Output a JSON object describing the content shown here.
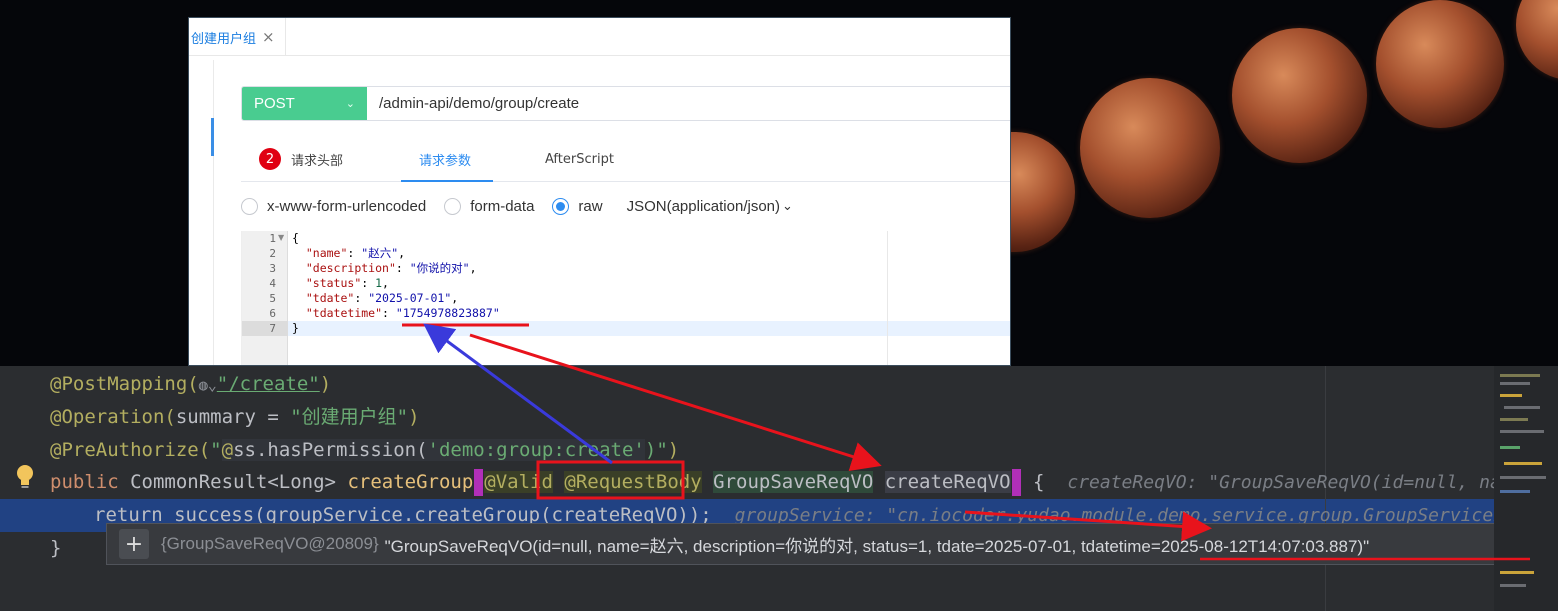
{
  "api_tool": {
    "tab_title": "创建用户组",
    "tab_close": "×",
    "method": "POST",
    "method_chevron": "⌄",
    "url": "/admin-api/demo/group/create",
    "tabs": [
      {
        "label": "请求头部",
        "badge": "2"
      },
      {
        "label": "请求参数"
      },
      {
        "label": "AfterScript"
      }
    ],
    "body_types": [
      {
        "label": "x-www-form-urlencoded",
        "checked": false
      },
      {
        "label": "form-data",
        "checked": false
      },
      {
        "label": "raw",
        "checked": true
      }
    ],
    "content_type": "JSON(application/json)",
    "content_type_chevron": "⌄",
    "line_numbers": [
      "1",
      "2",
      "3",
      "4",
      "5",
      "6",
      "7"
    ],
    "json_lines": {
      "open": "{",
      "name_key": "\"name\"",
      "name_val": "\"赵六\"",
      "desc_key": "\"description\"",
      "desc_val": "\"你说的对\"",
      "status_key": "\"status\"",
      "status_val": "1",
      "tdate_key": "\"tdate\"",
      "tdate_val": "\"2025-07-01\"",
      "tdatetime_key": "\"tdatetime\"",
      "tdatetime_val": "\"1754978823887\"",
      "close": "}"
    }
  },
  "ide": {
    "line1_annot": "@PostMapping(",
    "line1_path": "\"/create\"",
    "line1_close": ")",
    "line2_annot": "@Operation(",
    "line2_param": "summary = ",
    "line2_str": "\"创建用户组\"",
    "line2_close": ")",
    "line3_annot": "@PreAuthorize(",
    "line3_str_a": "\"",
    "line3_at": "@",
    "line3_ss": "ss.hasPermission(",
    "line3_perm": "'demo:group:create'",
    "line3_str_b": ")\"",
    "line3_close": ")",
    "line4_public": "public",
    "line4_ret": "CommonResult<Long>",
    "line4_method": "createGroup",
    "line4_valid": "@Valid",
    "line4_reqbody": "@RequestBody",
    "line4_type": "GroupSaveReqVO",
    "line4_param": "createReqVO",
    "line4_brace": "{",
    "line4_hint": "createReqVO: \"GroupSaveReqVO(id=null, name=",
    "line5_code": "return success(groupService.createGroup(createReqVO));",
    "line5_hint": "groupService: \"cn.iocoder.yudao.module.demo.service.group.GroupServiceImpl",
    "line6_brace": "}",
    "tooltip_plus": "+",
    "tooltip_obj": "{GroupSaveReqVO@20809}",
    "tooltip_value": "\"GroupSaveReqVO(id=null, name=赵六, description=你说的对, status=1, tdate=2025-07-01, tdatetime=2025-08-12T14:07:03.887)\""
  },
  "colors": {
    "method_post": "#49cc90",
    "accent_blue": "#2d8cf0",
    "badge_red": "#e00012",
    "annotation_red": "#e8131c",
    "annotation_blue": "#3a3adb",
    "ide_bg": "#2b2d30"
  }
}
